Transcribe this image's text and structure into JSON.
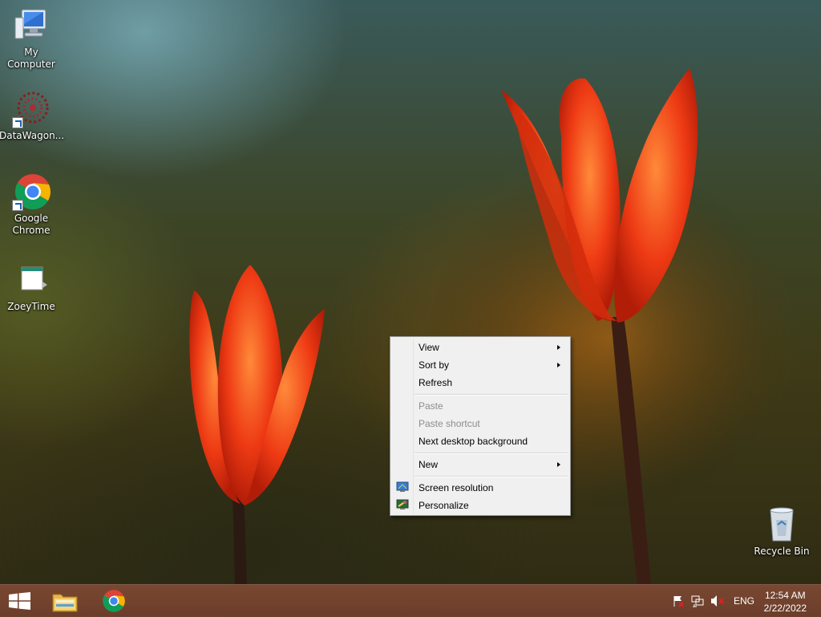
{
  "desktop": {
    "icons": [
      {
        "label": "My Computer",
        "icon": "computer-icon"
      },
      {
        "label": "DataWagon...",
        "icon": "datawagon-icon"
      },
      {
        "label": "Google Chrome",
        "icon": "chrome-icon"
      },
      {
        "label": "ZoeyTime",
        "icon": "zoeytime-icon"
      },
      {
        "label": "Recycle Bin",
        "icon": "recycle-bin-icon"
      }
    ]
  },
  "context_menu": {
    "items": [
      {
        "label": "View",
        "submenu": true,
        "enabled": true
      },
      {
        "label": "Sort by",
        "submenu": true,
        "enabled": true
      },
      {
        "label": "Refresh",
        "submenu": false,
        "enabled": true
      },
      {
        "label": "Paste",
        "submenu": false,
        "enabled": false
      },
      {
        "label": "Paste shortcut",
        "submenu": false,
        "enabled": false
      },
      {
        "label": "Next desktop background",
        "submenu": false,
        "enabled": true
      },
      {
        "label": "New",
        "submenu": true,
        "enabled": true
      },
      {
        "label": "Screen resolution",
        "submenu": false,
        "enabled": true,
        "icon": "screen-resolution-icon"
      },
      {
        "label": "Personalize",
        "submenu": false,
        "enabled": true,
        "icon": "personalize-icon"
      }
    ]
  },
  "taskbar": {
    "pinned": [
      {
        "name": "start",
        "icon": "windows-logo-icon"
      },
      {
        "name": "file-explorer",
        "icon": "folder-icon"
      },
      {
        "name": "chrome",
        "icon": "chrome-icon"
      }
    ],
    "tray": {
      "language": "ENG",
      "icons": [
        "action-center-flag-icon",
        "network-icon",
        "volume-muted-icon"
      ]
    },
    "clock": {
      "time": "12:54 AM",
      "date": "2/22/2022"
    }
  },
  "colors": {
    "taskbar": "#7a4634",
    "menu_bg": "#f0f0f0",
    "menu_disabled_text": "#8d8d8d"
  }
}
